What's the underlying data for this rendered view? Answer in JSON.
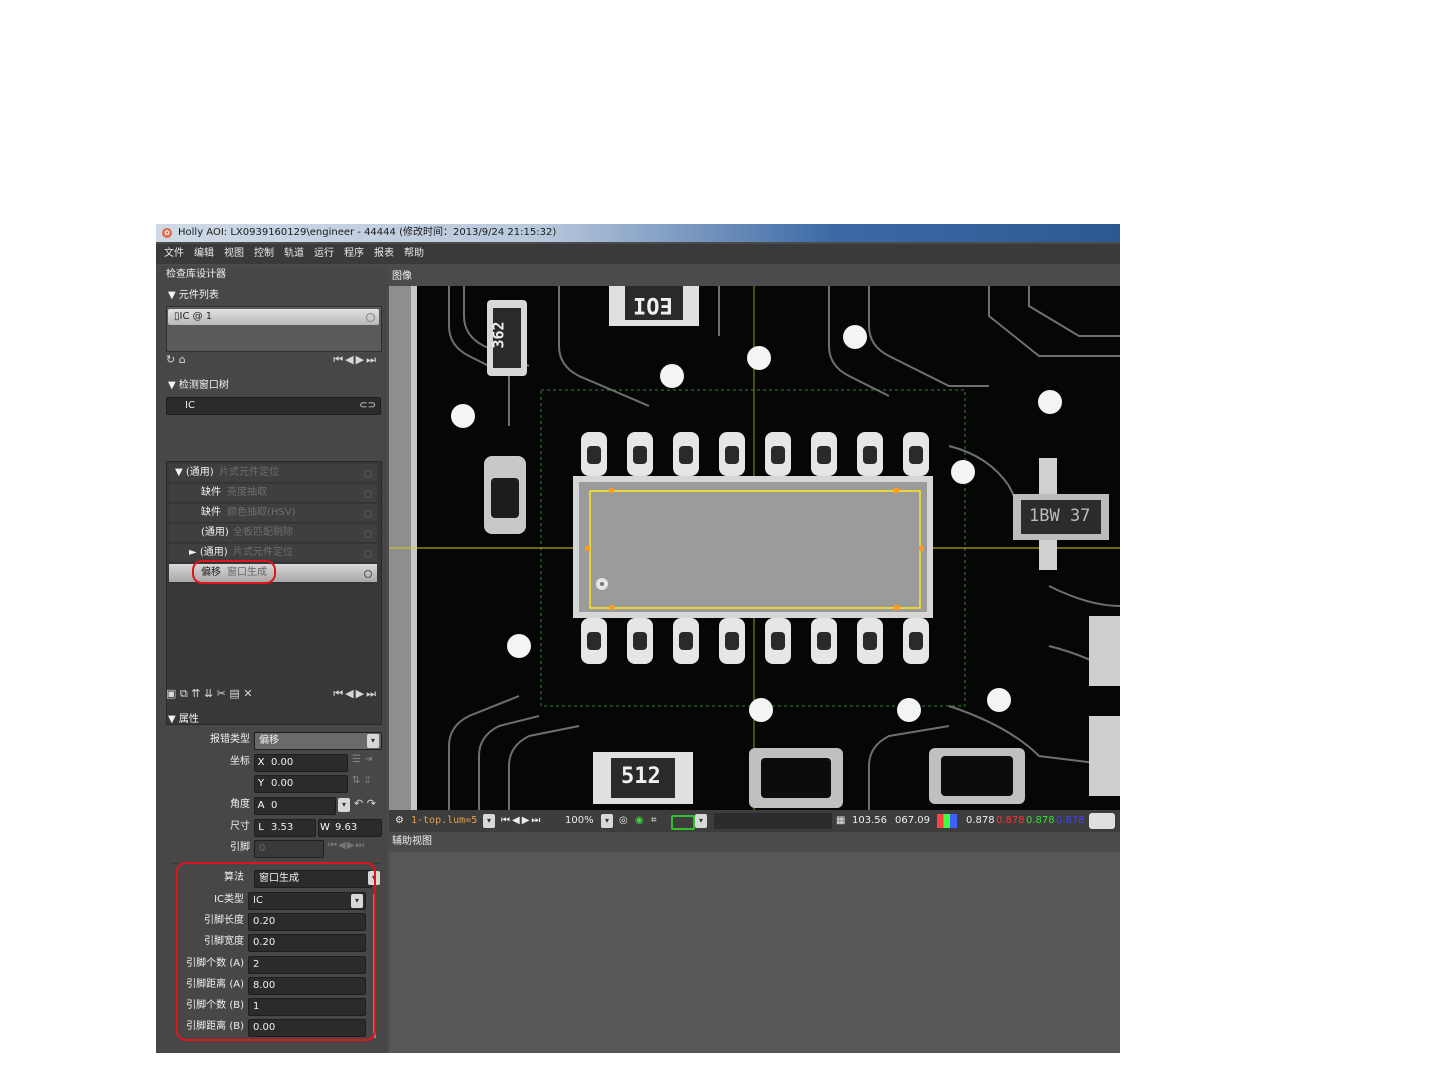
{
  "window": {
    "title": "Holly AOI: LX0939160129\\engineer - 44444 (修改时间：2013/9/24 21:15:32)"
  },
  "menu": [
    "文件",
    "编辑",
    "视图",
    "控制",
    "轨道",
    "运行",
    "程序",
    "报表",
    "帮助"
  ],
  "left_panel": {
    "title": "检查库设计器",
    "component_list": {
      "header": "▼ 元件列表",
      "item_label": "IC @ 1"
    },
    "window_tree": {
      "header": "▼ 检测窗口树",
      "search_value": "IC",
      "rows": [
        {
          "a": "▼ (通用)",
          "b": "片式元件定位"
        },
        {
          "a": "缺件",
          "b": "亮度抽取"
        },
        {
          "a": "缺件",
          "b": "颜色抽取(HSV)"
        },
        {
          "a": "(通用)",
          "b": "全板匹配剔除"
        },
        {
          "a": "► (通用)",
          "b": "片式元件定位"
        },
        {
          "a": "偏移",
          "b": "窗口生成"
        }
      ]
    },
    "properties": {
      "header": "▼ 属性",
      "error_type_label": "报错类型",
      "error_type_value": "偏移",
      "coord_label": "坐标",
      "x_prefix": "X",
      "x_value": "0.00",
      "y_prefix": "Y",
      "y_value": "0.00",
      "angle_label": "角度",
      "angle_prefix": "A",
      "angle_value": "0",
      "size_label": "尺寸",
      "l_prefix": "L",
      "l_value": "3.53",
      "w_prefix": "W",
      "w_value": "9.63",
      "pin_label": "引脚",
      "pin_value": "0",
      "algo_label": "算法",
      "algo_value": "窗口生成",
      "ic_type_label": "IC类型",
      "ic_type_value": "IC",
      "params": [
        {
          "label": "引脚长度",
          "value": "0.20"
        },
        {
          "label": "引脚宽度",
          "value": "0.20"
        },
        {
          "label": "引脚个数 (A)",
          "value": "2"
        },
        {
          "label": "引脚距离 (A)",
          "value": "8.00"
        },
        {
          "label": "引脚个数 (B)",
          "value": "1"
        },
        {
          "label": "引脚距离 (B)",
          "value": "0.00"
        }
      ]
    }
  },
  "image_panel": {
    "title": "图像",
    "labels": {
      "top": "EOI",
      "left": "362",
      "bottom": "512",
      "right": "1BW 37"
    }
  },
  "statusbar": {
    "file": "1-top.lum=5",
    "zoom": "100%",
    "coord_x": "103.56",
    "coord_y": "067.09",
    "lum": "0.878",
    "r": "0.878",
    "g": "0.878",
    "b": "0.878"
  },
  "aux_panel": {
    "title": "辅助视图"
  },
  "colors": {
    "accent_red": "#e0141c",
    "roi_yellow": "#ffe81a",
    "dark_bg": "#4b4b4b"
  }
}
